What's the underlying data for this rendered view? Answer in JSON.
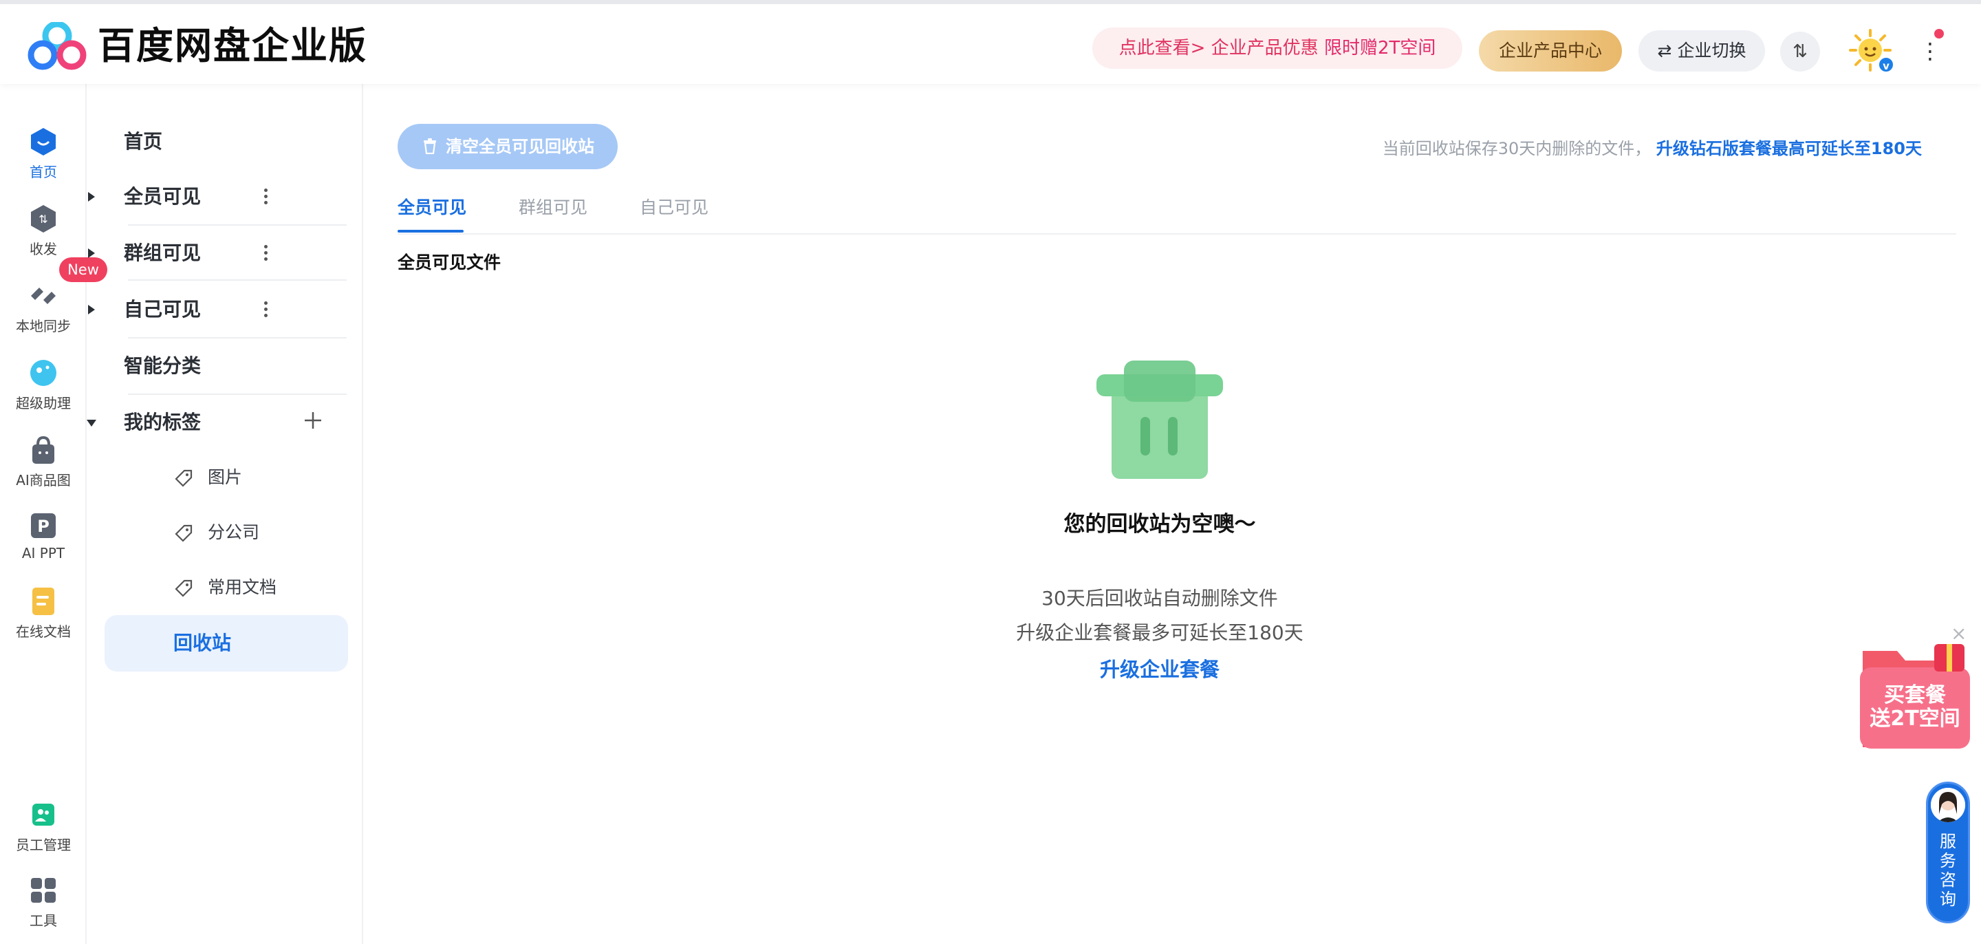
{
  "app": {
    "title": "百度网盘企业版"
  },
  "header": {
    "promo_prefix": "点此查看> 企业产品优惠",
    "promo_highlight": "限时赠2T空间",
    "product_center": "企业产品中心",
    "switch_label": "企业切换",
    "transfer_icon": "⇅",
    "vip_badge": "v"
  },
  "iconbar": {
    "items": [
      {
        "label": "首页",
        "icon": "home-icon",
        "active": true
      },
      {
        "label": "收发",
        "icon": "transfer-icon"
      },
      {
        "label": "本地同步",
        "icon": "sync-icon"
      },
      {
        "label": "超级助理",
        "icon": "assistant-icon"
      },
      {
        "label": "AI商品图",
        "icon": "ai-product-icon"
      },
      {
        "label": "AI PPT",
        "icon": "ai-ppt-icon"
      },
      {
        "label": "在线文档",
        "icon": "online-doc-icon"
      },
      {
        "label": "员工管理",
        "icon": "staff-icon"
      },
      {
        "label": "工具",
        "icon": "tools-icon"
      }
    ],
    "new_badge": "New"
  },
  "tree": {
    "home": "首页",
    "all_visible": "全员可见",
    "group_visible": "群组可见",
    "self_visible": "自己可见",
    "smart_category": "智能分类",
    "my_tags": "我的标签",
    "tags": [
      "图片",
      "分公司",
      "常用文档"
    ],
    "recycle_bin": "回收站"
  },
  "main": {
    "clear_button": "清空全员可见回收站",
    "notice_text": "当前回收站保存30天内删除的文件，",
    "notice_link": "升级钻石版套餐最高可延长至180天",
    "tabs": [
      "全员可见",
      "群组可见",
      "自己可见"
    ],
    "section_title": "全员可见文件",
    "empty": {
      "title": "您的回收站为空噢～",
      "line1": "30天后回收站自动删除文件",
      "line2": "升级企业套餐最多可延长至180天",
      "link": "升级企业套餐"
    }
  },
  "float": {
    "ad_line1": "买套餐",
    "ad_line2": "送2T空间",
    "close": "×",
    "service_chars": [
      "服",
      "务",
      "咨",
      "询"
    ]
  },
  "colors": {
    "accent": "#1a6fe0",
    "promo": "#e0325f",
    "empty_illustration": "#8fd9a2"
  }
}
